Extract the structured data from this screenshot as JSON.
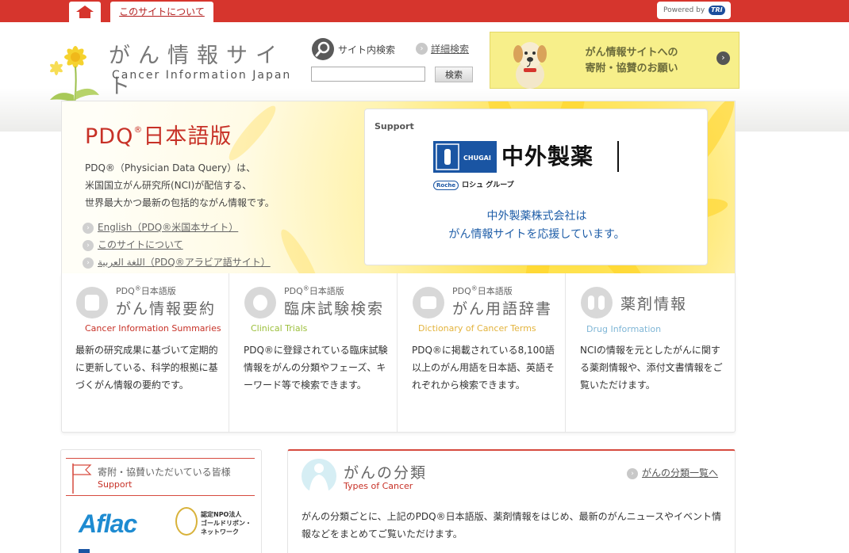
{
  "topbar": {
    "about_link": "このサイトについて",
    "powered_by": "Powered by",
    "powered_brand": "TRI"
  },
  "logo": {
    "title_jp": "がん情報サイト",
    "title_en": "Cancer Information Japan"
  },
  "search": {
    "label": "サイト内検索",
    "advanced_link": "詳細検索",
    "input_value": "",
    "button_label": "検索"
  },
  "donation": {
    "line1": "がん情報サイトへの",
    "line2": "寄附・協賛のお願い"
  },
  "hero": {
    "title": "PDQ",
    "title_sup": "®",
    "title_suffix": "日本語版",
    "desc_line1": "PDQ®（Physician Data Query）は、",
    "desc_line2": "米国国立がん研究所(NCI)が配信する、",
    "desc_line3": "世界最大かつ最新の包括的ながん情報です。",
    "links": [
      {
        "label": "English（PDQ®米国本サイト）"
      },
      {
        "label": "このサイトについて"
      },
      {
        "label": "اللغة العربية（PDQ®アラビア語サイト）"
      }
    ]
  },
  "support": {
    "label": "Support",
    "company_mark": "CHUGAI",
    "company_name": "中外製薬",
    "roche_mark": "Roche",
    "roche_group": "ロシュ グループ",
    "message_line1": "中外製薬株式会社は",
    "message_line2": "がん情報サイトを応援しています。"
  },
  "features": [
    {
      "sub": "PDQ",
      "sub_sup": "®",
      "sub_suffix": "日本語版",
      "title": "がん情報要約",
      "en": "Cancer Information Summaries",
      "en_color": "#c73127",
      "body": "最新の研究成果に基づいて定期的に更新している、科学的根拠に基づくがん情報の要約です。"
    },
    {
      "sub": "PDQ",
      "sub_sup": "®",
      "sub_suffix": "日本語版",
      "title": "臨床試験検索",
      "en": "Clinical Trials",
      "en_color": "#9bbf3a",
      "body": "PDQ®に登録されている臨床試験情報をがんの分類やフェーズ、キーワード等で検索できます。"
    },
    {
      "sub": "PDQ",
      "sub_sup": "®",
      "sub_suffix": "日本語版",
      "title": "がん用語辞書",
      "en": "Dictionary of Cancer Terms",
      "en_color": "#e3b33c",
      "body": "PDQ®に掲載されている8,100語以上のがん用語を日本語、英語それぞれから検索できます。"
    },
    {
      "sub": "",
      "sub_sup": "",
      "sub_suffix": "",
      "title": "薬剤情報",
      "en": "Drug Information",
      "en_color": "#7fb6d6",
      "body": "NCIの情報を元としたがんに関する薬剤情報や、添付文書情報をご覧いただけます。"
    }
  ],
  "sponsors": {
    "title": "寄附・協賛いただいている皆様",
    "en": "Support",
    "aflac": "Aflac",
    "goldribbon_line1": "認定NPO法人",
    "goldribbon_line2": "ゴールドリボン・",
    "goldribbon_line3": "ネットワーク"
  },
  "types": {
    "title": "がんの分類",
    "en": "Types of Cancer",
    "link": "がんの分類一覧へ",
    "body": "がんの分類ごとに、上記のPDQ®日本語版、薬剤情報をはじめ、最新のがんニュースやイベント情報などをまとめてご覧いただけます。"
  },
  "colors": {
    "brand_red": "#d6352d",
    "link_blue": "#1f5ea8",
    "hero_yellow": "#ffe14a"
  }
}
